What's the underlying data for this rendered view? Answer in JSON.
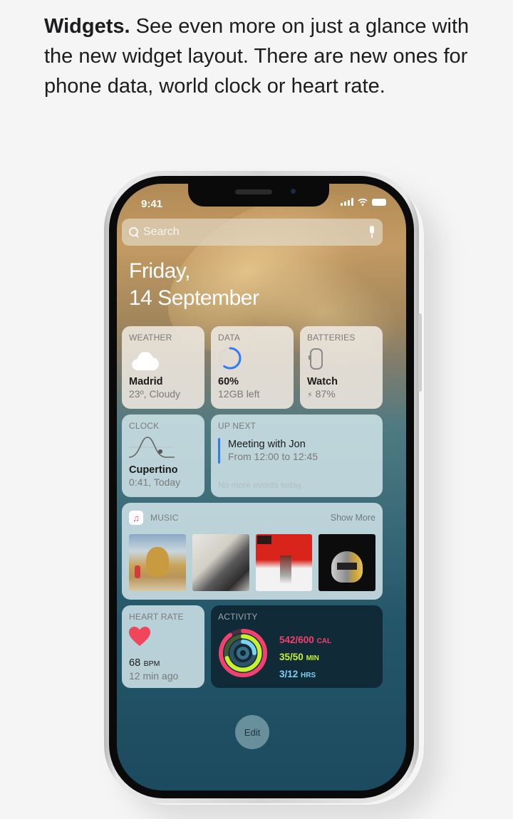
{
  "intro": {
    "heading": "Widgets.",
    "body": " See even more on just a glance with the new widget layout. There are new ones for phone data, world clock or heart rate."
  },
  "status_bar": {
    "time": "9:41"
  },
  "search": {
    "placeholder": "Search"
  },
  "date": {
    "line1": "Friday,",
    "line2": "14 September"
  },
  "widgets": {
    "weather": {
      "title": "WEATHER",
      "city": "Madrid",
      "condition": "23º, Cloudy",
      "icon": "cloud-icon"
    },
    "data": {
      "title": "DATA",
      "percent_label": "60%",
      "remaining": "12GB left",
      "usage_fraction": 0.6,
      "ring_color": "#2f7cf6"
    },
    "batteries": {
      "title": "BATTERIES",
      "device": "Watch",
      "level": "87%",
      "charging_symbol": "⚡",
      "icon": "watch-icon"
    },
    "clock": {
      "title": "CLOCK",
      "city": "Cupertino",
      "time": "0:41, Today"
    },
    "up_next": {
      "title": "UP NEXT",
      "event": "Meeting with Jon",
      "time": "From 12:00 to 12:45",
      "footer": "No more events today.",
      "accent": "#2f7cf6"
    },
    "music": {
      "title": "MUSIC",
      "show_more": "Show More",
      "albums": [
        {
          "name": "album-astroworld",
          "colors": [
            "#c9b07a",
            "#8aa7c4"
          ]
        },
        {
          "name": "album-a-star-is-born",
          "colors": [
            "#e8e6e0",
            "#4a4a4a"
          ]
        },
        {
          "name": "album-anti",
          "colors": [
            "#d9241c",
            "#f2f2f2"
          ]
        },
        {
          "name": "album-random-access-memories",
          "colors": [
            "#0c0c0c",
            "#b7b7b7"
          ]
        }
      ]
    },
    "heart_rate": {
      "title": "HEART RATE",
      "value": "68",
      "unit": "BPM",
      "time": "12 min ago",
      "color": "#f0455a"
    },
    "activity": {
      "title": "ACTIVITY",
      "move": {
        "value": "542/600",
        "unit": "CAL",
        "color": "#f2416e",
        "fraction": 0.9
      },
      "exercise": {
        "value": "35/50",
        "unit": "MIN",
        "color": "#c6f22e",
        "fraction": 0.7
      },
      "stand": {
        "value": "3/12",
        "unit": "HRS",
        "color": "#7ed0f5",
        "fraction": 0.25
      }
    }
  },
  "edit_button": {
    "label": "Edit"
  }
}
